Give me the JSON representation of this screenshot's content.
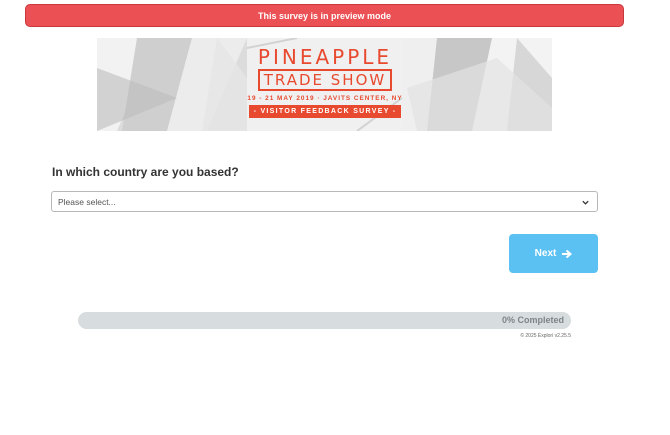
{
  "banner": {
    "text": "This survey is in preview mode",
    "color": "#eb5055"
  },
  "hero": {
    "title": "PINEAPPLE",
    "subtitle": "TRADE SHOW",
    "date_line": "19 - 21 MAY 2019 · JAVITS CENTER, NY",
    "ribbon": "- VISITOR FEEDBACK SURVEY -",
    "accent": "#e84a2f"
  },
  "question": {
    "text": "In which country are you based?",
    "select_value": "Please select...",
    "chevron_icon": "chevron-down-icon"
  },
  "navigation": {
    "next_label": "Next",
    "next_icon": "arrow-right-icon",
    "button_color": "#5bc0f2"
  },
  "progress": {
    "percent": 0,
    "label": "0% Completed"
  },
  "footer": {
    "text": "© 2025 Explori v2.25.5"
  }
}
